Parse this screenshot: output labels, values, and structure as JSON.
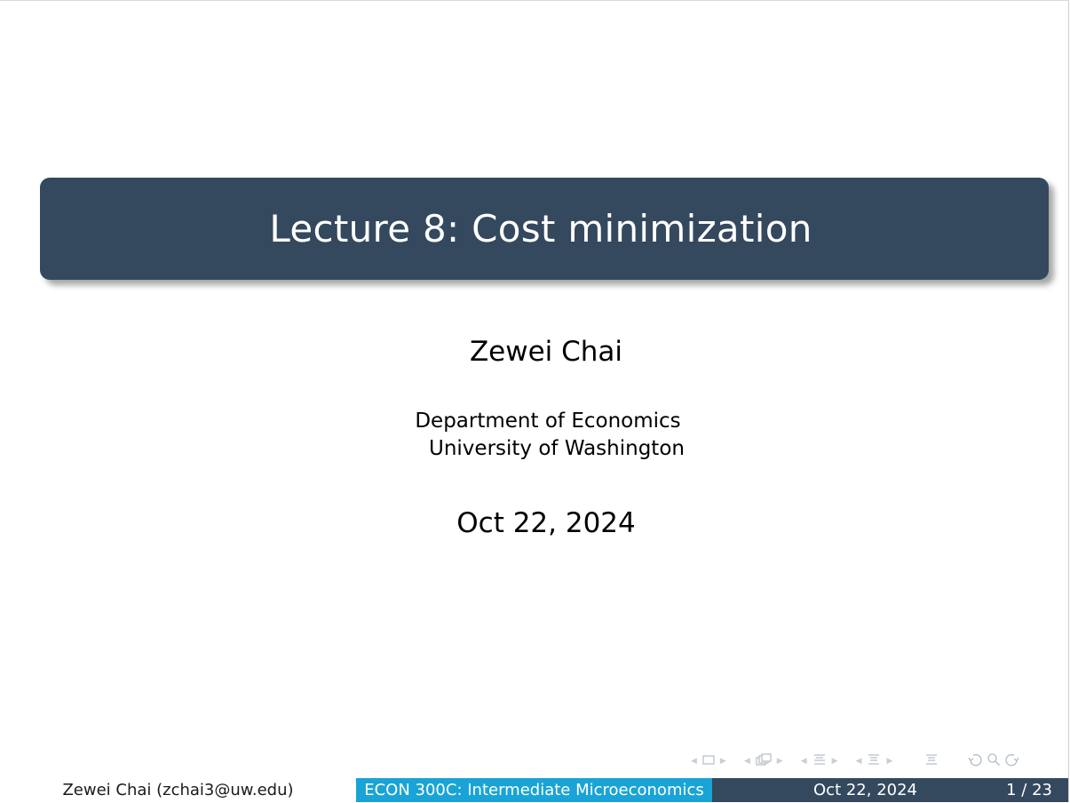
{
  "slide": {
    "title": "Lecture 8: Cost minimization",
    "author": "Zewei Chai",
    "institute_line1": "Department of Economics",
    "institute_line2": "University of Washington",
    "date": "Oct 22, 2024"
  },
  "footer": {
    "author": "Zewei Chai  (zchai3@uw.edu)",
    "course": "ECON 300C: Intermediate Microeconomics",
    "date": "Oct 22, 2024",
    "page": "1 / 23"
  },
  "nav_icons": [
    "prev-frame-icon",
    "frame-icon",
    "next-frame-icon",
    "prev-subsection-icon",
    "subsection-icon",
    "next-subsection-icon",
    "prev-section-icon",
    "section-icon",
    "next-section-icon",
    "prev-part-icon",
    "part-icon",
    "next-part-icon",
    "toc-icon",
    "undo-icon",
    "search-icon",
    "redo-icon"
  ],
  "colors": {
    "title_bg": "#34495e",
    "footer_course_bg": "#1aa3d6",
    "footer_right_bg": "#34495e"
  }
}
